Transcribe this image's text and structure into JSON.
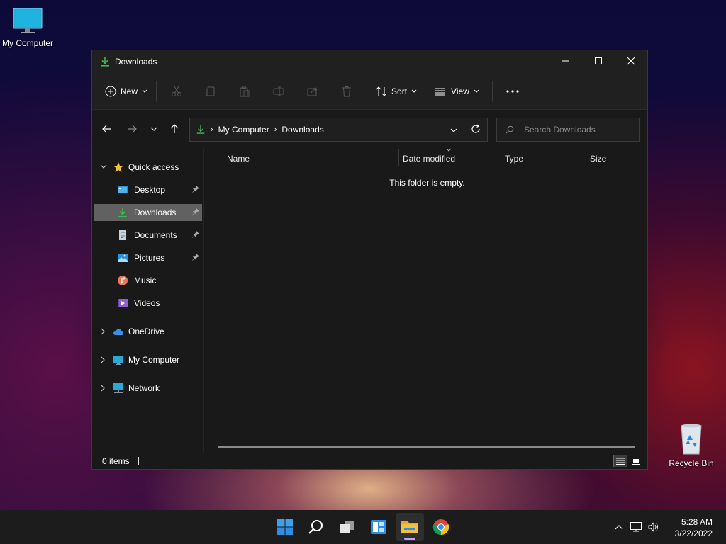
{
  "desktop": {
    "my_computer": "My Computer",
    "recycle_bin": "Recycle Bin"
  },
  "window": {
    "title": "Downloads",
    "commands": {
      "new": "New",
      "sort": "Sort",
      "view": "View"
    },
    "address": {
      "crumbs": [
        "My Computer",
        "Downloads"
      ]
    },
    "search": {
      "placeholder": "Search Downloads"
    },
    "sidebar": {
      "quick_access": "Quick access",
      "items": [
        {
          "label": "Desktop",
          "icon": "desktop-folder-icon",
          "pinned": true
        },
        {
          "label": "Downloads",
          "icon": "downloads-folder-icon",
          "pinned": true,
          "selected": true
        },
        {
          "label": "Documents",
          "icon": "documents-folder-icon",
          "pinned": true
        },
        {
          "label": "Pictures",
          "icon": "pictures-folder-icon",
          "pinned": true
        },
        {
          "label": "Music",
          "icon": "music-folder-icon",
          "pinned": false
        },
        {
          "label": "Videos",
          "icon": "videos-folder-icon",
          "pinned": false
        }
      ],
      "onedrive": "OneDrive",
      "my_computer": "My Computer",
      "network": "Network"
    },
    "columns": [
      "Name",
      "Date modified",
      "Type",
      "Size"
    ],
    "empty_message": "This folder is empty.",
    "status": {
      "items": "0 items"
    }
  },
  "taskbar": {
    "apps": [
      "start-icon",
      "search-icon",
      "task-view-icon",
      "widgets-icon",
      "file-explorer-icon",
      "chrome-icon"
    ],
    "clock": {
      "time": "5:28 AM",
      "date": "3/22/2022"
    }
  },
  "colors": {
    "accent_green": "#3fb950",
    "window_bg": "#191919",
    "selected_bg": "#616161",
    "folder_yellow": "#f3c03d"
  }
}
